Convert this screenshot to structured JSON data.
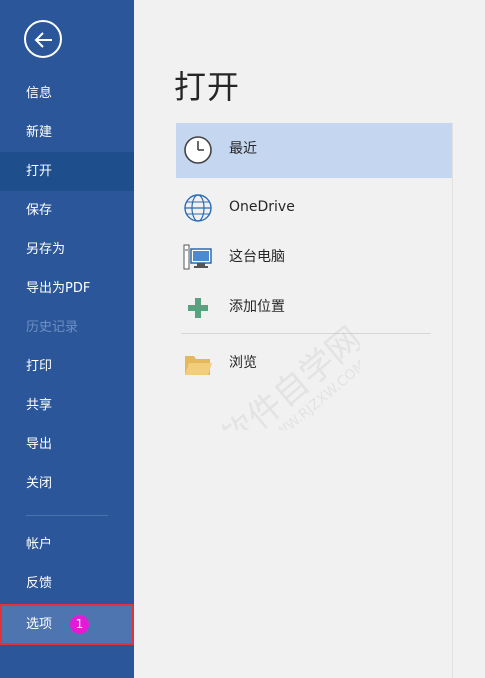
{
  "sidebar": {
    "back_icon": "back-arrow-icon",
    "items": [
      {
        "label": "信息"
      },
      {
        "label": "新建"
      },
      {
        "label": "打开"
      },
      {
        "label": "保存"
      },
      {
        "label": "另存为"
      },
      {
        "label": "导出为PDF"
      },
      {
        "label": "历史记录"
      },
      {
        "label": "打印"
      },
      {
        "label": "共享"
      },
      {
        "label": "导出"
      },
      {
        "label": "关闭"
      },
      {
        "label": "帐户"
      },
      {
        "label": "反馈"
      },
      {
        "label": "选项"
      }
    ],
    "options_badge": "1"
  },
  "main": {
    "title": "打开",
    "locations": [
      {
        "label": "最近",
        "icon": "clock-icon"
      },
      {
        "label": "OneDrive",
        "icon": "globe-icon"
      },
      {
        "label": "这台电脑",
        "icon": "computer-icon"
      },
      {
        "label": "添加位置",
        "icon": "plus-icon"
      },
      {
        "label": "浏览",
        "icon": "folder-icon"
      }
    ]
  },
  "colors": {
    "sidebar": "#2b579a",
    "sidebar_active": "#1e4e8c",
    "highlight": "#c5d6f0",
    "callout_border": "#e2323a",
    "badge": "#e21bd7"
  },
  "watermark": "软件自学网 WWW.RJZXW.COM"
}
